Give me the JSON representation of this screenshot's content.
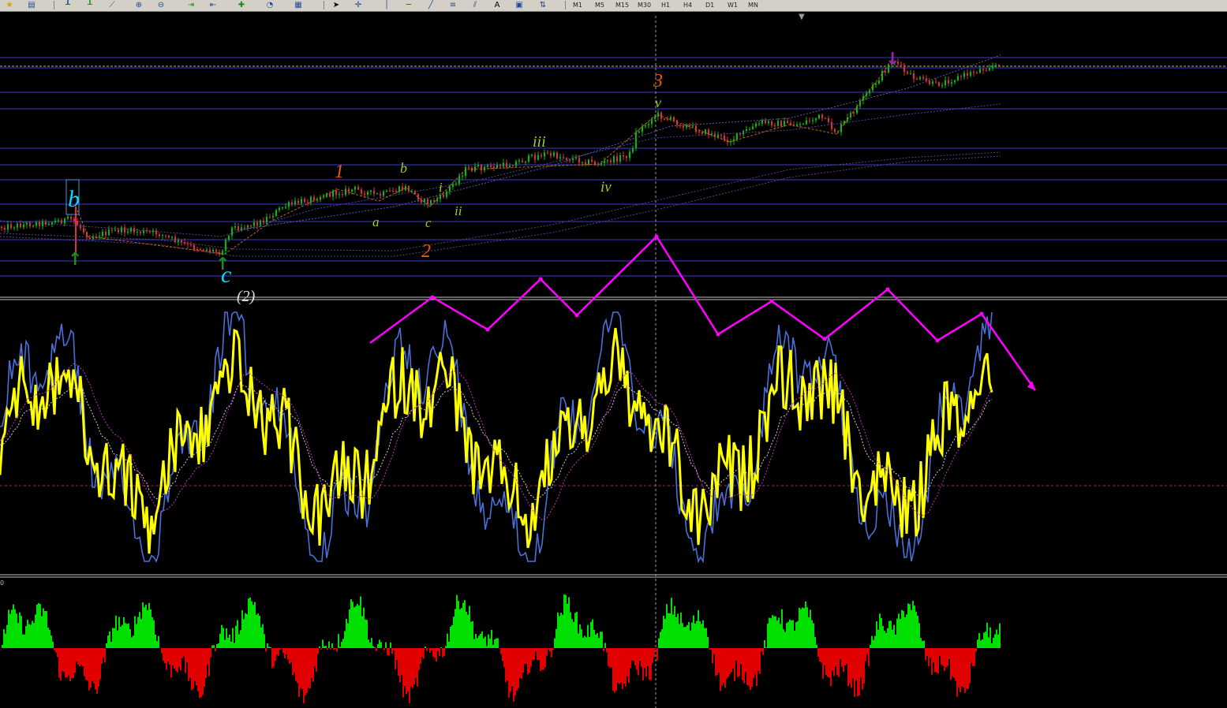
{
  "toolbar": {
    "icons": [
      "star-icon",
      "document-icon",
      "bar-chart-icon",
      "candle-chart-icon",
      "line-chart-icon",
      "zoom-in-icon",
      "zoom-out-icon",
      "autoscroll-icon",
      "chart-shift-icon",
      "indicators-icon",
      "periods-icon",
      "templates-icon",
      "cursor-icon",
      "crosshair-icon",
      "vertical-line-icon",
      "horizontal-line-icon",
      "trendline-icon",
      "fibonacci-icon",
      "channel-icon",
      "text-icon",
      "label-icon",
      "arrows-icon"
    ],
    "timeframes": [
      "M1",
      "M5",
      "M15",
      "M30",
      "H1",
      "H4",
      "D1",
      "W1",
      "MN"
    ]
  },
  "colors": {
    "background": "#000000",
    "level_line": "#3a3ad8",
    "yellow_line": "#ffff00",
    "blue_line": "#4a6fd8",
    "magenta": "#ff00ff",
    "hist_up": "#00e000",
    "hist_down": "#e00000",
    "wave_orange": "#e8551c",
    "wave_green": "#9acd32",
    "wave_cyan": "#00ddff"
  },
  "wave_labels": {
    "b_major": "b",
    "c_major": "c",
    "one": "1",
    "two": "2",
    "three": "3",
    "a_minor": "a",
    "b_minor": "b",
    "c_minor": "c",
    "i": "i",
    "ii": "ii",
    "iii": "iii",
    "iv": "iv",
    "v": "v",
    "partial_label": "(2)"
  },
  "subwindow2": {
    "scale_label": "0"
  }
}
